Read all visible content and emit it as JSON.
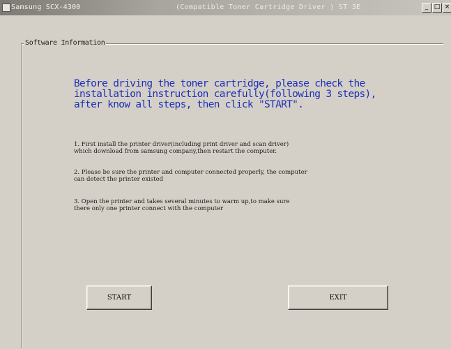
{
  "window": {
    "title": "Samsung SCX-4300",
    "subtitle": "(Compatible Toner Cartridge Driver )  ST 3E",
    "controls": {
      "minimize": "_",
      "maximize": "□",
      "close": "×"
    }
  },
  "group": {
    "label": "Software Information"
  },
  "heading": {
    "lines": [
      "Before driving the toner cartridge, please check the",
      "installation instruction carefully(following 3 steps),",
      "after know all steps, then click \"START\"."
    ]
  },
  "steps": [
    {
      "lines": [
        "1. First install the printer driver(including print driver and scan driver)",
        "which download from samsung company,then restart the computer."
      ]
    },
    {
      "lines": [
        "2. Please be sure the printer and computer connected properly, the computer",
        "can detect the printer existed"
      ]
    },
    {
      "lines": [
        "3. Open the printer and takes several minutes to warm up,to make sure",
        "there only one printer connect with the computer"
      ]
    }
  ],
  "buttons": {
    "start": "START",
    "exit": "EXIT"
  }
}
